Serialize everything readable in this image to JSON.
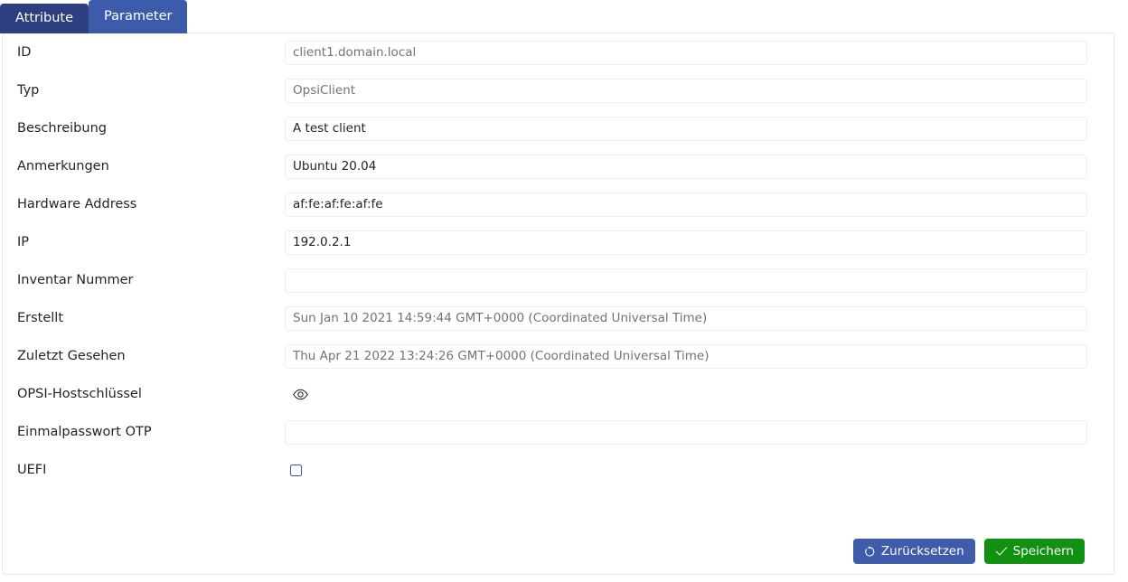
{
  "tabs": [
    {
      "id": "attribute",
      "label": "Attribute",
      "active": true
    },
    {
      "id": "parameter",
      "label": "Parameter",
      "active": false
    }
  ],
  "colors": {
    "tab_active": "#2e3f7f",
    "tab_inactive": "#3c5cab",
    "reset_button": "#3f5cab",
    "save_button": "#119011",
    "checkbox_border": "#3f51a3",
    "field_border": "#eceef0",
    "readonly_text": "#6c757d",
    "text": "#212529"
  },
  "form": {
    "rows": [
      {
        "label": "ID",
        "type": "text",
        "value": "client1.domain.local",
        "placeholder": "",
        "readonly": true,
        "name": "id"
      },
      {
        "label": "Typ",
        "type": "text",
        "value": "OpsiClient",
        "placeholder": "",
        "readonly": true,
        "name": "typ"
      },
      {
        "label": "Beschreibung",
        "type": "text",
        "value": "A test client",
        "placeholder": "",
        "readonly": false,
        "name": "beschreibung"
      },
      {
        "label": "Anmerkungen",
        "type": "text",
        "value": "Ubuntu 20.04",
        "placeholder": "",
        "readonly": false,
        "name": "anmerkungen"
      },
      {
        "label": "Hardware Address",
        "type": "text",
        "value": "af:fe:af:fe:af:fe",
        "placeholder": "",
        "readonly": false,
        "name": "hardware-address"
      },
      {
        "label": "IP",
        "type": "text",
        "value": "192.0.2.1",
        "placeholder": "",
        "readonly": false,
        "name": "ip"
      },
      {
        "label": "Inventar Nummer",
        "type": "text",
        "value": "",
        "placeholder": "",
        "readonly": false,
        "name": "inventar-nummer"
      },
      {
        "label": "Erstellt",
        "type": "text",
        "value": "Sun Jan 10 2021 14:59:44 GMT+0000 (Coordinated Universal Time)",
        "placeholder": "",
        "readonly": true,
        "name": "erstellt"
      },
      {
        "label": "Zuletzt Gesehen",
        "type": "text",
        "value": "Thu Apr 21 2022 13:24:26 GMT+0000 (Coordinated Universal Time)",
        "placeholder": "",
        "readonly": true,
        "name": "zuletzt-gesehen"
      },
      {
        "label": "OPSI-Hostschlüssel",
        "type": "eye",
        "value": "",
        "placeholder": "",
        "readonly": false,
        "name": "opsi-hostschluessel"
      },
      {
        "label": "Einmalpasswort OTP",
        "type": "text",
        "value": "",
        "placeholder": "",
        "readonly": false,
        "name": "einmalpasswort-otp"
      },
      {
        "label": "UEFI",
        "type": "checkbox",
        "checked": false,
        "name": "uefi"
      }
    ]
  },
  "footer": {
    "reset_label": "Zurücksetzen",
    "save_label": "Speichern"
  }
}
